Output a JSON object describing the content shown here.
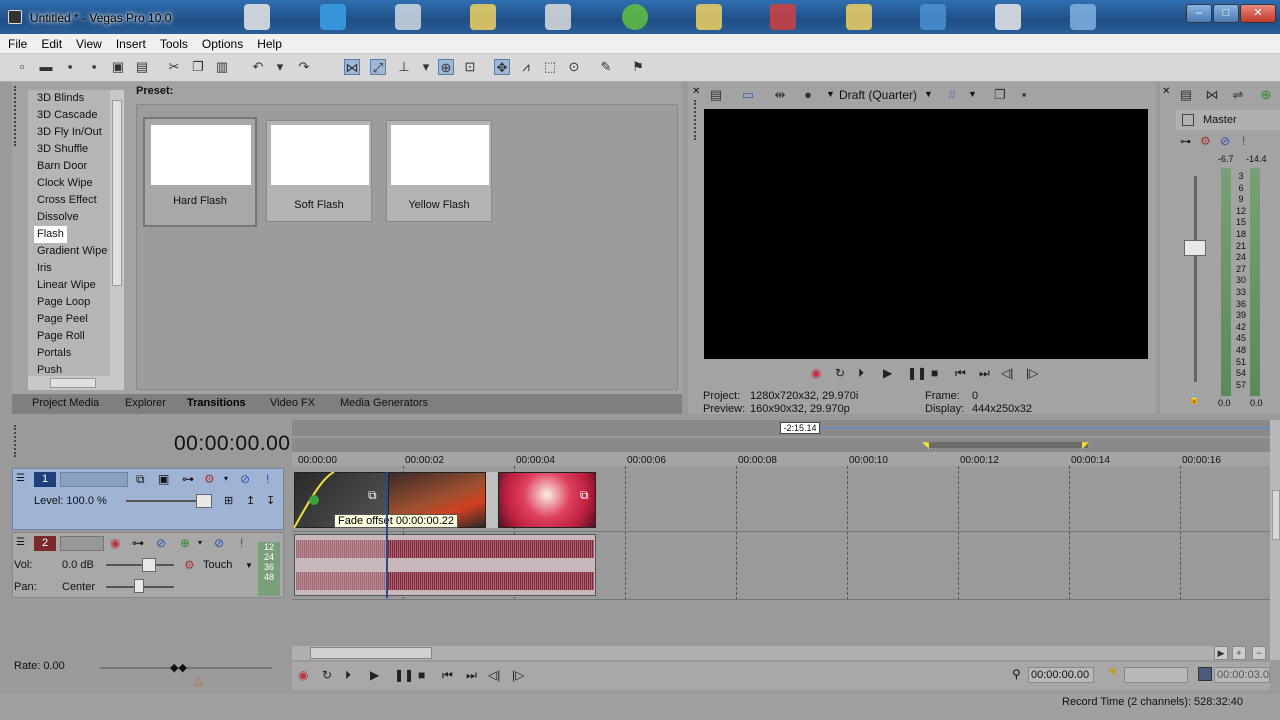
{
  "window": {
    "title": "Untitled * - Vegas Pro 10.0",
    "minimize": "–",
    "maximize": "□",
    "close": "✕"
  },
  "menu": [
    "File",
    "Edit",
    "View",
    "Insert",
    "Tools",
    "Options",
    "Help"
  ],
  "transitions": {
    "list": [
      "3D Blinds",
      "3D Cascade",
      "3D Fly In/Out",
      "3D Shuffle",
      "Barn Door",
      "Clock Wipe",
      "Cross Effect",
      "Dissolve",
      "Flash",
      "Gradient Wipe",
      "Iris",
      "Linear Wipe",
      "Page Loop",
      "Page Peel",
      "Page Roll",
      "Portals",
      "Push"
    ],
    "selected": "Flash",
    "preset_label": "Preset:",
    "presets": [
      "Hard Flash",
      "Soft Flash",
      "Yellow Flash"
    ]
  },
  "tabs": [
    "Project Media",
    "Explorer",
    "Transitions",
    "Video FX",
    "Media Generators"
  ],
  "active_tab": "Transitions",
  "preview": {
    "quality": "Draft (Quarter)",
    "project_label": "Project:",
    "project_value": "1280x720x32, 29.970i",
    "preview_label": "Preview:",
    "preview_value": "160x90x32, 29.970p",
    "frame_label": "Frame:",
    "frame_value": "0",
    "display_label": "Display:",
    "display_value": "444x250x32"
  },
  "mixer": {
    "label": "Master",
    "peak_left": "-6.7",
    "peak_right": "-14.4",
    "scale": [
      "3",
      "6",
      "9",
      "12",
      "15",
      "18",
      "21",
      "24",
      "27",
      "30",
      "33",
      "36",
      "39",
      "42",
      "45",
      "48",
      "51",
      "54",
      "57"
    ],
    "bottom_left": "0.0",
    "bottom_right": "0.0"
  },
  "timeline": {
    "timecode": "00:00:00.00",
    "loop_length": "-2:15.14",
    "ruler": [
      "00:00:00",
      "00:00:02",
      "00:00:04",
      "00:00:06",
      "00:00:08",
      "00:00:10",
      "00:00:12",
      "00:00:14",
      "00:00:16"
    ],
    "tooltip": "Fade offset 00:00:00.22",
    "track1": {
      "number": "1",
      "level": "Level: 100.0 %"
    },
    "track2": {
      "number": "2",
      "vol_label": "Vol:",
      "vol_value": "0.0 dB",
      "pan_label": "Pan:",
      "pan_value": "Center",
      "automation": "Touch",
      "meter": [
        "12",
        "24",
        "36",
        "48"
      ]
    },
    "rate": "Rate: 0.00"
  },
  "transport": {
    "cursor_time": "00:00:00.00",
    "end_time": "00:00:03.00"
  },
  "status": {
    "record_time": "Record Time (2 channels): 528:32:40"
  },
  "colors": {
    "track_header_active": "#9fb4d4",
    "clip_video_bg": "#3a3a3a",
    "waveform": "#8a3040",
    "titlebar": "#2a5f98"
  }
}
